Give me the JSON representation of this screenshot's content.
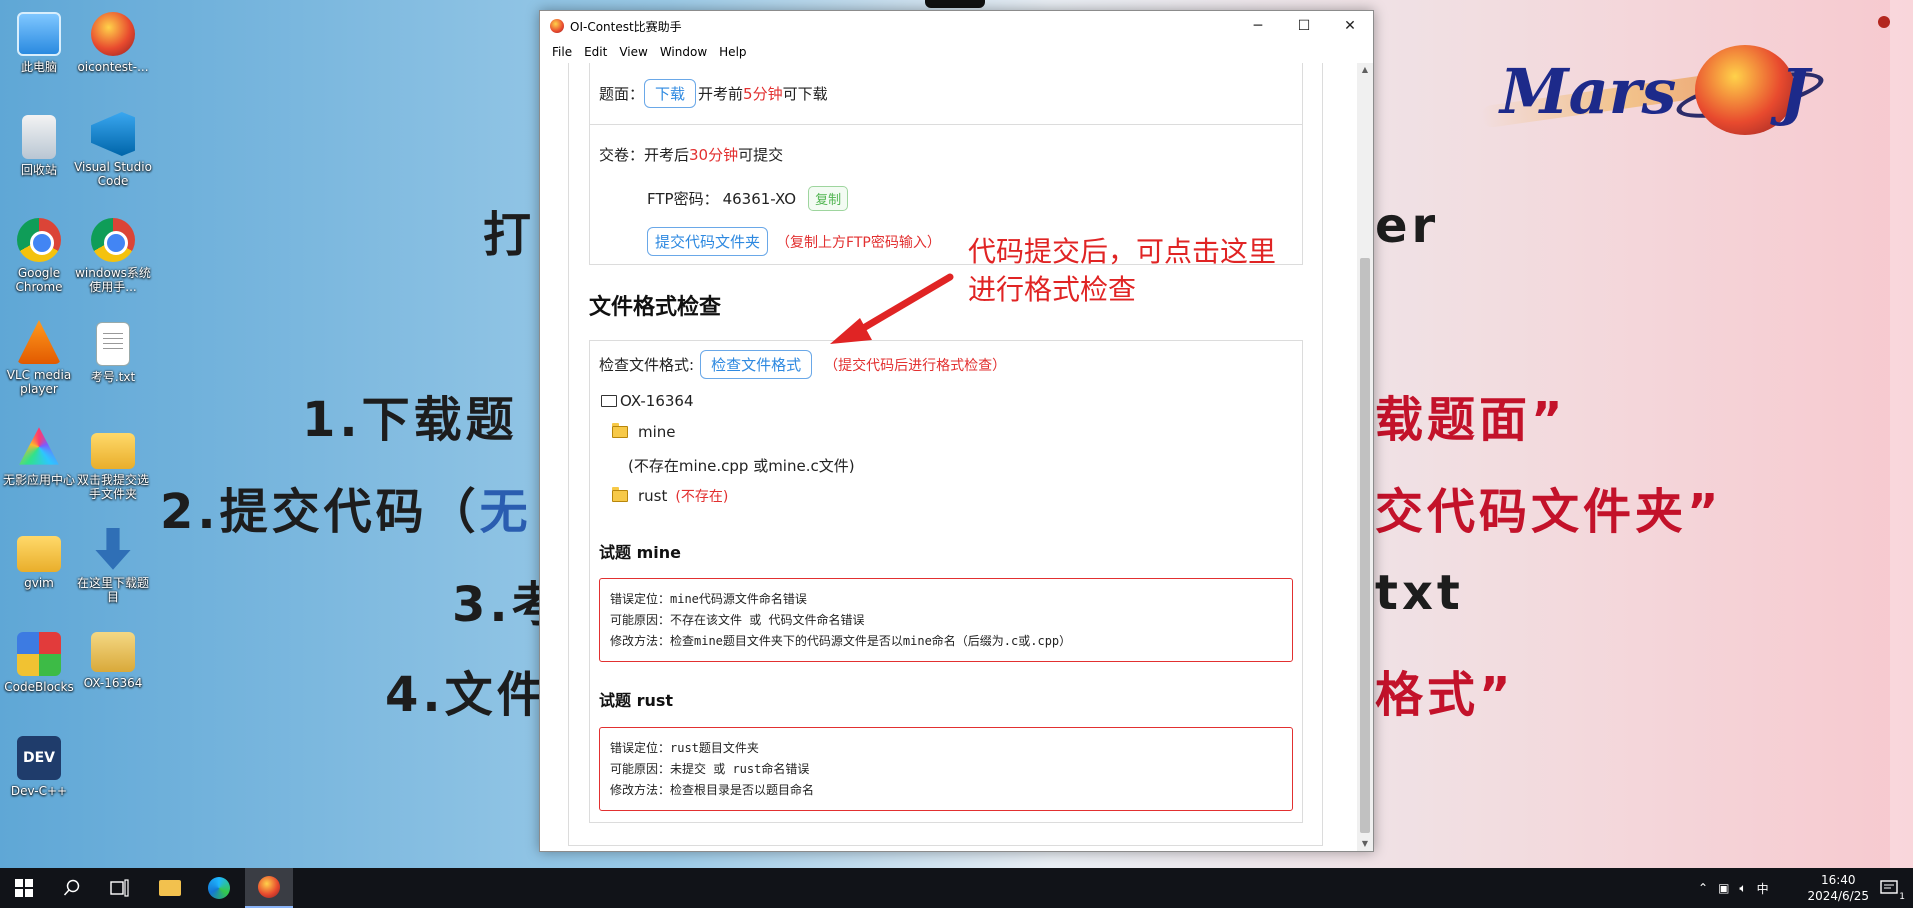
{
  "window": {
    "title": "OI-Contest比赛助手",
    "controls": {
      "minimize": "─",
      "maximize": "☐",
      "close": "✕"
    }
  },
  "menu": [
    "File",
    "Edit",
    "View",
    "Window",
    "Help"
  ],
  "download": {
    "label": "题面：",
    "button": "下载",
    "text_before": "开考前",
    "highlight": "5分钟",
    "text_after": "可下载"
  },
  "submit": {
    "label": "交卷：开考后",
    "highlight": "30分钟",
    "text_after": "可提交",
    "ftp_label": "FTP密码：",
    "ftp_password": "46361-XO",
    "copy_button": "复制",
    "submit_button": "提交代码文件夹",
    "submit_note": "（复制上方FTP密码输入）"
  },
  "format_check": {
    "heading": "文件格式检查",
    "label": "检查文件格式:",
    "button": "检查文件格式",
    "note": "（提交代码后进行格式检查）",
    "tree": {
      "root": "OX-16364",
      "mine": "mine",
      "mine_note": "(不存在mine.cpp 或mine.c文件)",
      "rust": "rust",
      "rust_note": "(不存在)"
    }
  },
  "problems": [
    {
      "title": "试题 mine",
      "lines": [
        "错误定位：mine代码源文件命名错误",
        "可能原因：不存在该文件 或 代码文件命名错误",
        "修改方法：检查mine题目文件夹下的代码源文件是否以mine命名（后缀为.c或.cpp）"
      ]
    },
    {
      "title": "试题 rust",
      "lines": [
        "错误定位：rust题目文件夹",
        "可能原因：未提交 或 rust命名错误",
        "修改方法：检查根目录是否以题目命名"
      ]
    }
  ],
  "annotation": {
    "line1": "代码提交后，可点击这里",
    "line2": "进行格式检查",
    "color": "#e02424"
  },
  "desktop_icons": [
    {
      "label": "此电脑",
      "icon": "computer-icon"
    },
    {
      "label": "oicontest-...",
      "icon": "oicontest-icon"
    },
    {
      "label": "回收站",
      "icon": "recycle-bin-icon"
    },
    {
      "label": "Visual Studio Code",
      "icon": "vscode-icon"
    },
    {
      "label": "Google Chrome",
      "icon": "chrome-icon"
    },
    {
      "label": "windows系统使用手...",
      "icon": "chrome-icon"
    },
    {
      "label": "VLC media player",
      "icon": "vlc-icon"
    },
    {
      "label": "考号.txt",
      "icon": "text-file-icon"
    },
    {
      "label": "无影应用中心",
      "icon": "prism-icon"
    },
    {
      "label": "双击我提交选手文件夹",
      "icon": "folder-icon"
    },
    {
      "label": "gvim",
      "icon": "folder-icon"
    },
    {
      "label": "在这里下载题目",
      "icon": "download-icon"
    },
    {
      "label": "CodeBlocks",
      "icon": "codeblocks-icon"
    },
    {
      "label": "OX-16364",
      "icon": "zip-folder-icon"
    },
    {
      "label": "Dev-C++",
      "icon": "devcpp-icon"
    }
  ],
  "slide": {
    "line1_left": "打",
    "line1_right": "er",
    "line2_left": "1.下载题",
    "line2_right": "载题面”",
    "line3_left": "2.提交代码（",
    "line3_left_blue": "无",
    "line3_right": "交代码文件夹”",
    "line4_left": "3.考",
    "line4_right": "txt",
    "line5_left": "4.文件",
    "line5_right": "格式”",
    "logo_text_left": "Mars",
    "logo_text_right": "J"
  },
  "taskbar": {
    "ime": "中",
    "time": "16:40",
    "date": "2024/6/25",
    "notification_count": "1"
  }
}
